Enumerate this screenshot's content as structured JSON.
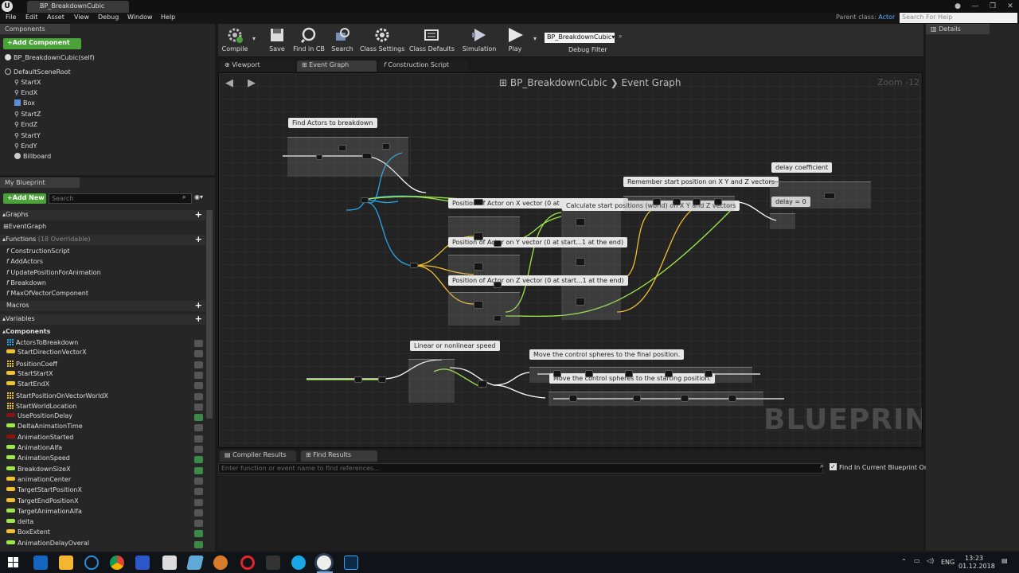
{
  "window": {
    "doc_tab": "BP_BreakdownCubic",
    "parent_class_label": "Parent class:",
    "parent_class_value": "Actor",
    "search_help_placeholder": "Search For Help"
  },
  "menu": [
    "File",
    "Edit",
    "Asset",
    "View",
    "Debug",
    "Window",
    "Help"
  ],
  "components_panel": {
    "tab": "Components",
    "add_button": "+Add Component",
    "self_item": "BP_BreakdownCubic(self)",
    "root": "DefaultSceneRoot",
    "children": [
      "StartX",
      "EndX",
      "Box",
      "StartZ",
      "EndZ",
      "StartY",
      "EndY",
      "Billboard"
    ]
  },
  "my_blueprint": {
    "tab": "My Blueprint",
    "add_new": "+Add New",
    "search_placeholder": "Search",
    "graphs_header": "Graphs",
    "graphs": [
      "EventGraph"
    ],
    "functions_header": "Functions",
    "functions_count": "(18 Overridable)",
    "functions": [
      "ConstructionScript",
      "AddActors",
      "UpdatePositionForAnimation",
      "Breakdown",
      "MaxOfVectorComponent"
    ],
    "macros_header": "Macros",
    "variables_header": "Variables",
    "components_subheader": "Components",
    "variables": [
      {
        "name": "ActorsToBreakdown",
        "kind": "grid",
        "color": "#2aa4e6",
        "public": false
      },
      {
        "name": "StartDirectionVectorX",
        "kind": "pill",
        "color": "#f2c12e",
        "public": false
      },
      {
        "name": "PositionCoeff",
        "kind": "grid",
        "color": "#f2c12e",
        "public": false
      },
      {
        "name": "StartStartX",
        "kind": "pill",
        "color": "#f2c12e",
        "public": false
      },
      {
        "name": "StartEndX",
        "kind": "pill",
        "color": "#f2c12e",
        "public": false
      },
      {
        "name": "StartPositionOnVectorWorldX",
        "kind": "grid",
        "color": "#f2c12e",
        "public": false
      },
      {
        "name": "StartWorldLocation",
        "kind": "grid",
        "color": "#f2c12e",
        "public": false
      },
      {
        "name": "UsePositionDelay",
        "kind": "pill",
        "color": "#8a1414",
        "public": true
      },
      {
        "name": "DeltaAnimationTime",
        "kind": "pill",
        "color": "#9fe84a",
        "public": false
      },
      {
        "name": "AnimationStarted",
        "kind": "pill",
        "color": "#8a1414",
        "public": false
      },
      {
        "name": "AnimationAlfa",
        "kind": "pill",
        "color": "#9fe84a",
        "public": false
      },
      {
        "name": "AnimationSpeed",
        "kind": "pill",
        "color": "#9fe84a",
        "public": true
      },
      {
        "name": "BreakdownSizeX",
        "kind": "pill",
        "color": "#9fe84a",
        "public": true
      },
      {
        "name": "animationCenter",
        "kind": "pill",
        "color": "#f2c12e",
        "public": false
      },
      {
        "name": "TargetStartPositionX",
        "kind": "pill",
        "color": "#f2c12e",
        "public": false
      },
      {
        "name": "TargetEndPositionX",
        "kind": "pill",
        "color": "#f2c12e",
        "public": false
      },
      {
        "name": "TargetAnimationAlfa",
        "kind": "pill",
        "color": "#9fe84a",
        "public": false
      },
      {
        "name": "delta",
        "kind": "pill",
        "color": "#9fe84a",
        "public": false
      },
      {
        "name": "BoxExtent",
        "kind": "pill",
        "color": "#f2c12e",
        "public": true
      },
      {
        "name": "AnimationDelayOveral",
        "kind": "pill",
        "color": "#9fe84a",
        "public": true
      }
    ]
  },
  "toolbar": {
    "buttons": [
      "Compile",
      "Save",
      "Find in CB",
      "Search",
      "Class Settings",
      "Class Defaults",
      "Simulation",
      "Play"
    ],
    "debug_select": "BP_BreakdownCubic",
    "debug_filter": "Debug Filter"
  },
  "graph_tabs": [
    "Viewport",
    "Event Graph",
    "Construction Script"
  ],
  "graph": {
    "breadcrumb_bp": "BP_BreakdownCubic",
    "breadcrumb_graph": "Event Graph",
    "zoom": "Zoom -12",
    "watermark": "BLUEPRINT",
    "comments": [
      "Find Actors to breakdown",
      "Position of Actor on X vector (0 at start...1 at the end)",
      "Calculate start positions (world) on X Y and Z vectors",
      "Position of Actor on Y vector (0 at start...1 at the end)",
      "Position of Actor on Z vector (0 at start...1 at the end)",
      "Remember start position on X Y and Z vectors",
      "delay coefficient",
      "delay = 0",
      "Linear or nonlinear speed",
      "Move the control spheres to the final position.",
      "Move the control spheres to the starting position."
    ]
  },
  "details": {
    "tab": "Details"
  },
  "bottom": {
    "tabs": [
      "Compiler Results",
      "Find Results"
    ],
    "find_placeholder": "Enter function or event name to find references...",
    "find_current_only": "Find In Current Blueprint Only"
  },
  "taskbar": {
    "lang": "ENG",
    "time": "13:23",
    "date": "01.12.2018"
  },
  "colors": {
    "exec": "#ffffff",
    "float": "#9fe84a",
    "vector": "#f2c12e",
    "object": "#2aa4e6",
    "accent_green": "#4aa338"
  }
}
